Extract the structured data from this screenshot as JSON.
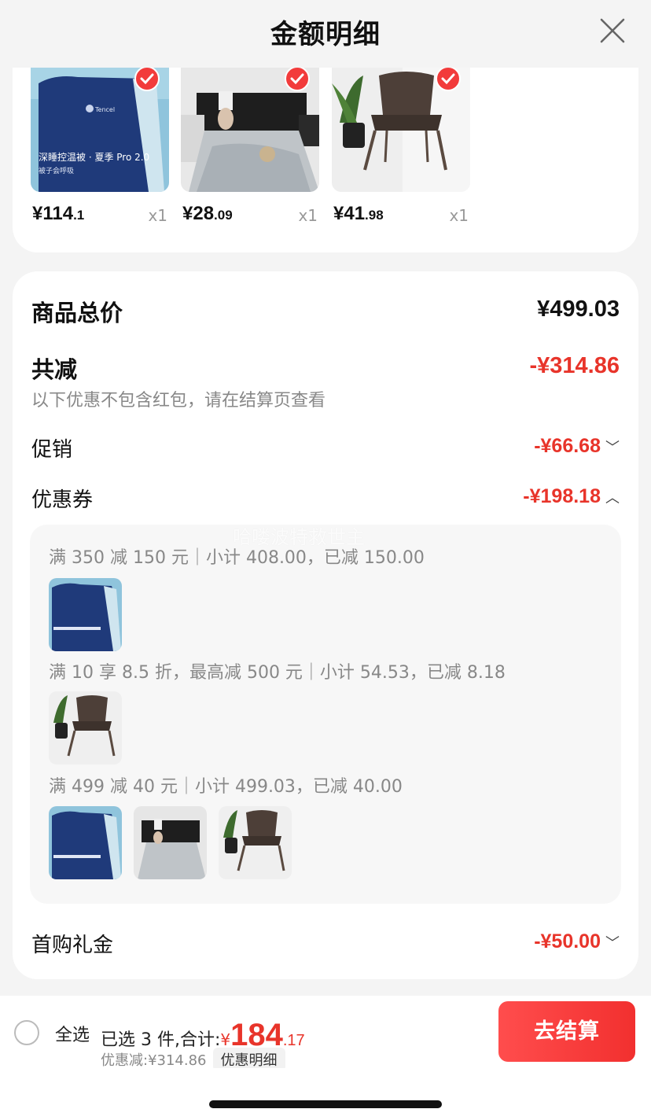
{
  "header": {
    "title": "金额明细"
  },
  "products": [
    {
      "price_int": "¥114",
      "price_dec": ".1",
      "qty": "x1",
      "image": "quilt-navy",
      "thumb_text": "深睡控温被 · 夏季 Pro 2.0",
      "thumb_sub": "被子会呼吸"
    },
    {
      "price_int": "¥28",
      "price_dec": ".09",
      "qty": "x1",
      "image": "quilt-grey-bedroom"
    },
    {
      "price_int": "¥41",
      "price_dec": ".98",
      "qty": "x1",
      "image": "wicker-chair"
    }
  ],
  "detail": {
    "goods_total_label": "商品总价",
    "goods_total_value": "¥499.03",
    "total_reduce_label": "共减",
    "total_reduce_value": "-¥314.86",
    "note": "以下优惠不包含红包，请在结算页查看",
    "promo_label": "促销",
    "promo_value": "-¥66.68",
    "coupon_label": "优惠券",
    "coupon_value": "-¥198.18",
    "gift_label": "首购礼金",
    "gift_value": "-¥50.00"
  },
  "coupons": [
    {
      "text": "满 350 减 150 元｜小计 408.00，已减 150.00"
    },
    {
      "text": "满 10 享 8.5 折，最高减 500 元｜小计 54.53，已减 8.18"
    },
    {
      "text": "满 499 减 40 元｜小计 499.03，已减 40.00"
    }
  ],
  "watermark": "哈喽波特救世主",
  "bottom": {
    "select_all": "全选",
    "selected_text": "已选 3 件,合计:",
    "total_yen": "¥",
    "total_int": "184",
    "total_dec": ".17",
    "discount_text": "优惠减:¥314.86",
    "detail_chip": "优惠明细",
    "checkout": "去结算"
  },
  "colors": {
    "accent_red": "#e8342a",
    "checkout_red": "#f2302f",
    "background": "#f4f4f4"
  },
  "icons": [
    "close-icon",
    "check-badge-icon",
    "chevron-down-icon",
    "chevron-up-icon",
    "radio-unchecked-icon"
  ]
}
